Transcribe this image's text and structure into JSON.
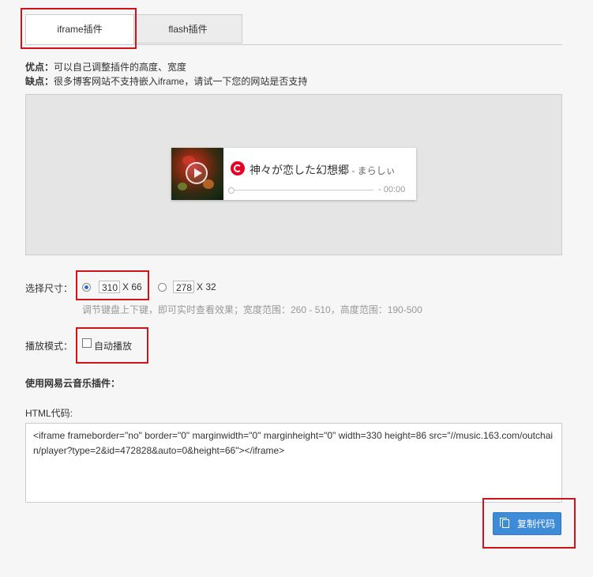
{
  "tabs": [
    {
      "label": "iframe插件",
      "active": true
    },
    {
      "label": "flash插件",
      "active": false
    }
  ],
  "description": {
    "pro_label": "优点：",
    "pro_text": "可以自己调整插件的高度、宽度",
    "con_label": "缺点：",
    "con_text": "很多博客网站不支持嵌入iframe，请试一下您的网站是否支持"
  },
  "player": {
    "song_title": "神々が恋した幻想郷",
    "artist": " - まらしぃ",
    "time": "- 00:00",
    "icons": {
      "play": "play-icon",
      "brand": "netease-music-icon"
    }
  },
  "size": {
    "label": "选择尺寸：",
    "options": [
      {
        "width": "310",
        "height_text": "X 66",
        "selected": true
      },
      {
        "width": "278",
        "height_text": "X 32",
        "selected": false
      }
    ],
    "hint": "调节键盘上下键，即可实时查看效果；宽度范围：260 - 510，高度范围：190-500"
  },
  "mode": {
    "label": "播放模式：",
    "autoplay_label": "自动播放",
    "autoplay_checked": false
  },
  "section_title": "使用网易云音乐插件：",
  "html_code": {
    "label": "HTML代码:",
    "value": "<iframe frameborder=\"no\" border=\"0\" marginwidth=\"0\" marginheight=\"0\" width=330 height=86 src=\"//music.163.com/outchain/player?type=2&id=472828&auto=0&height=66\"></iframe>"
  },
  "copy_button": {
    "label": "复制代码"
  },
  "colors": {
    "accent_button": "#3e8bd8",
    "annotation_red": "#d0121b",
    "netease_red": "#e60026"
  }
}
